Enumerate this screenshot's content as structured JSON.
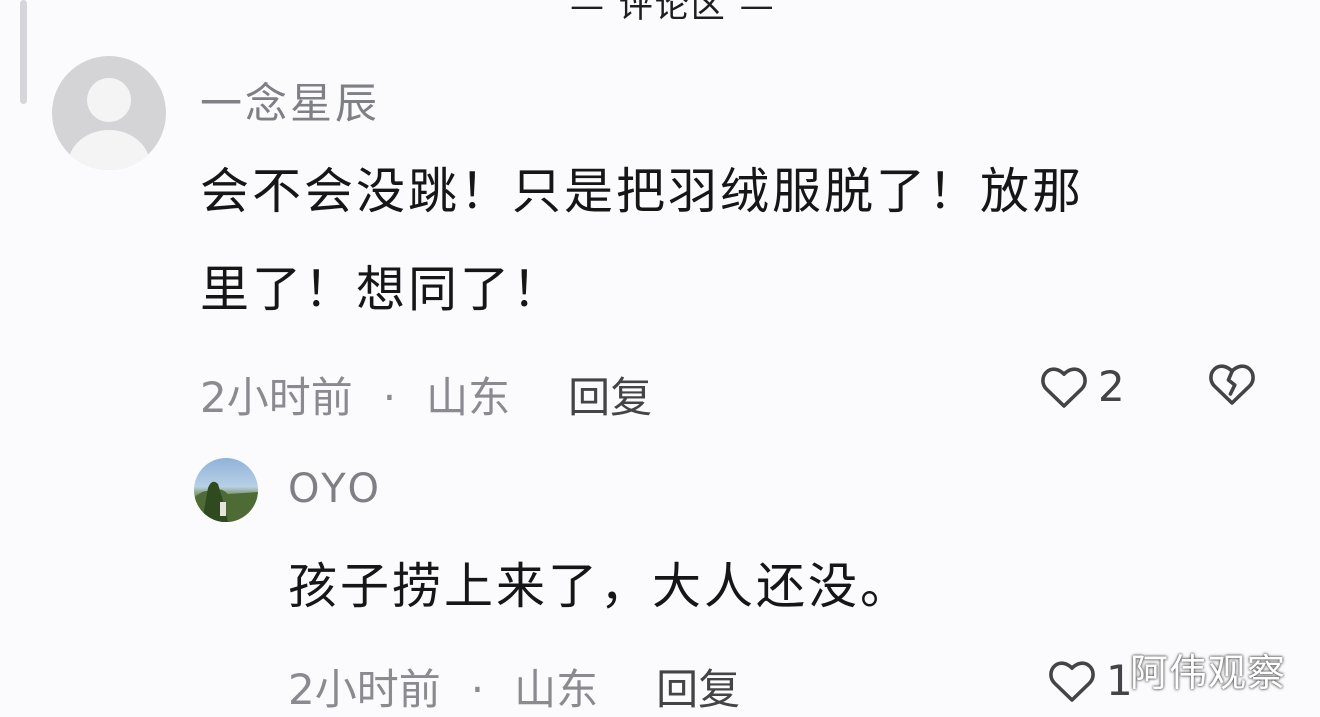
{
  "comments": [
    {
      "username": "一念星辰",
      "lines": [
        "会不会没跳！只是把羽绒服脱了！放那",
        "里了！想同了！"
      ],
      "time": "2小时前",
      "dot": "·",
      "location": "山东",
      "reply": "回复",
      "likes": "2",
      "avatar": "default-user-avatar"
    },
    {
      "username": "OYO",
      "lines": [
        "孩子捞上来了，大人还没。"
      ],
      "time": "2小时前",
      "dot": "·",
      "location": "山东",
      "reply": "回复",
      "likes": "1",
      "avatar": "landscape-photo-avatar"
    }
  ],
  "watermark": "阿伟观察",
  "icons": {
    "like": "heart-outline-icon",
    "dislike": "broken-heart-icon"
  },
  "colors": {
    "background": "#fbfbfd",
    "meta": "#8a8a90",
    "text": "#161616"
  }
}
